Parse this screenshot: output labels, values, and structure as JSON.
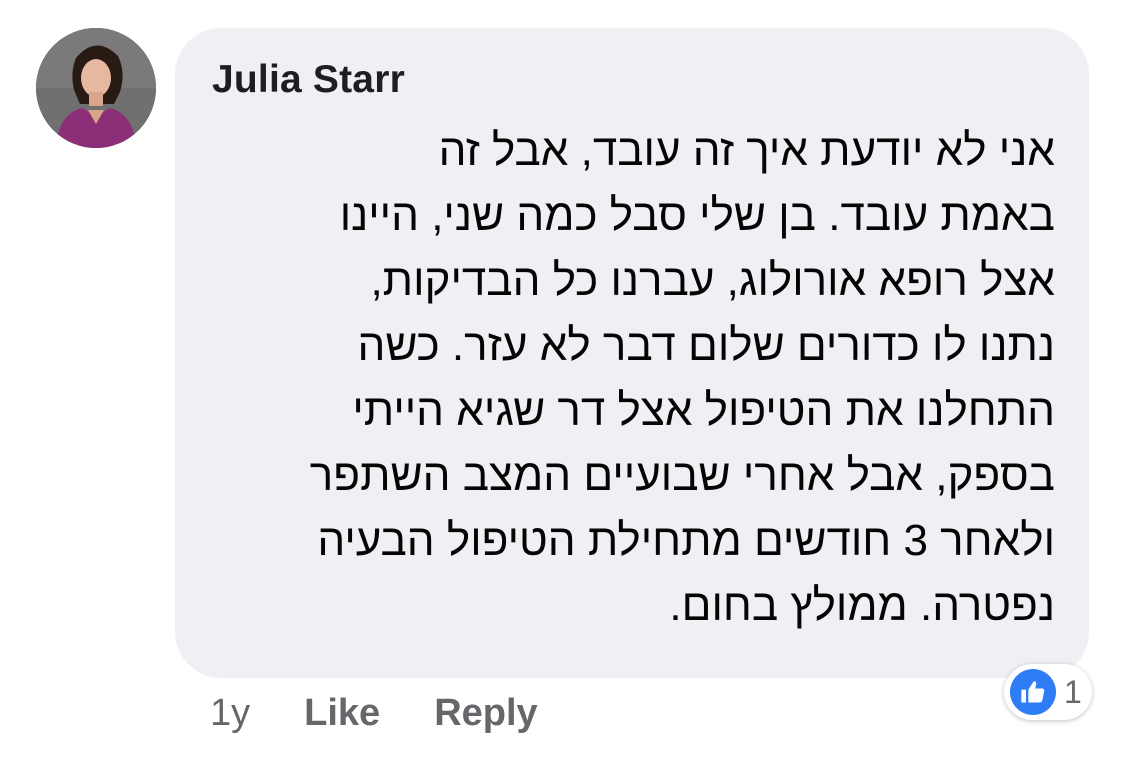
{
  "comment": {
    "author": "Julia Starr",
    "body_lines": [
      "אני לא יודעת איך זה עובד, אבל זה",
      "באמת עובד. בן שלי סבל כמה שני, היינו",
      "אצל רופא אורולוג, עברנו כל הבדיקות,",
      "נתנו לו כדורים שלום דבר לא עזר. כשה",
      "התחלנו את הטיפול אצל דר שגיא הייתי",
      "בספק, אבל אחרי שבועיים המצב השתפר",
      "ולאחר 3 חודשים מתחילת הטיפול הבעיה",
      "נפטרה. ממולץ בחום."
    ]
  },
  "actions": {
    "time": "1y",
    "like_label": "Like",
    "reply_label": "Reply"
  },
  "reaction": {
    "icon": "thumbs-up-icon",
    "count": "1",
    "color": "#2e7df5"
  }
}
